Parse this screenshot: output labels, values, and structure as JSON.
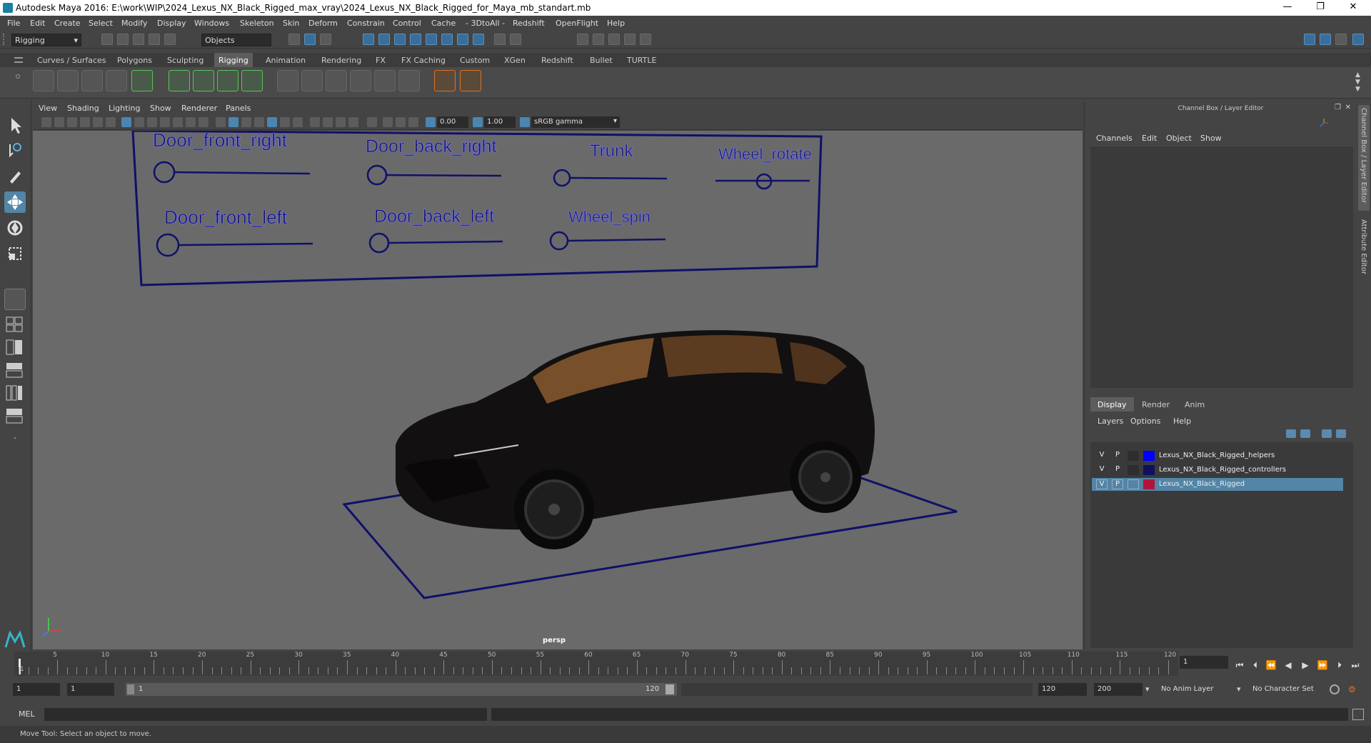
{
  "window": {
    "title": "Autodesk Maya 2016: E:\\work\\WIP\\2024_Lexus_NX_Black_Rigged_max_vray\\2024_Lexus_NX_Black_Rigged_for_Maya_mb_standart.mb",
    "minimize": "—",
    "maximize": "❐",
    "close": "✕"
  },
  "menubar": [
    "File",
    "Edit",
    "Create",
    "Select",
    "Modify",
    "Display",
    "Windows",
    "Skeleton",
    "Skin",
    "Deform",
    "Constrain",
    "Control",
    "Cache",
    "- 3DtoAll -",
    "Redshift",
    "OpenFlight",
    "Help"
  ],
  "statusline": {
    "mode": "Rigging",
    "objects": "Objects"
  },
  "shelf_tabs": [
    "Curves / Surfaces",
    "Polygons",
    "Sculpting",
    "Rigging",
    "Animation",
    "Rendering",
    "FX",
    "FX Caching",
    "Custom",
    "XGen",
    "Redshift",
    "Bullet",
    "TURTLE"
  ],
  "viewport": {
    "menus": [
      "View",
      "Shading",
      "Lighting",
      "Show",
      "Renderer",
      "Panels"
    ],
    "exposure": "0.00",
    "gamma": "1.00",
    "colorspace": "sRGB gamma",
    "camera": "persp"
  },
  "controls": {
    "door_front_right": "Door_front_right",
    "door_back_right": "Door_back_right",
    "trunk": "Trunk",
    "wheel_rotate": "Wheel_rotate",
    "door_front_left": "Door_front_left",
    "door_back_left": "Door_back_left",
    "wheel_spin": "Wheel_spin"
  },
  "channelbox": {
    "title": "Channel Box / Layer Editor",
    "menus": [
      "Channels",
      "Edit",
      "Object",
      "Show"
    ]
  },
  "layer_editor": {
    "tabs": [
      "Display",
      "Render",
      "Anim"
    ],
    "menus": [
      "Layers",
      "Options",
      "Help"
    ],
    "layers": [
      {
        "v": "V",
        "p": "P",
        "color": "#0000ff",
        "name": "Lexus_NX_Black_Rigged_helpers"
      },
      {
        "v": "V",
        "p": "P",
        "color": "#101060",
        "name": "Lexus_NX_Black_Rigged_controllers"
      },
      {
        "v": "V",
        "p": "P",
        "color": "#b0143c",
        "name": "Lexus_NX_Black_Rigged"
      }
    ]
  },
  "side_tabs": [
    "Channel Box / Layer Editor",
    "Attribute Editor"
  ],
  "timeline": {
    "ticks": [
      "1",
      "5",
      "10",
      "15",
      "20",
      "25",
      "30",
      "35",
      "40",
      "45",
      "50",
      "55",
      "60",
      "65",
      "70",
      "75",
      "80",
      "85",
      "90",
      "95",
      "100",
      "105",
      "110",
      "115",
      "120"
    ],
    "current_frame": "1"
  },
  "range": {
    "start": "1",
    "playback_start": "1",
    "slider_start": "1",
    "slider_end": "120",
    "playback_end": "120",
    "end": "200",
    "anim_layer": "No Anim Layer",
    "character_set": "No Character Set"
  },
  "cmdline": {
    "label": "MEL"
  },
  "helpline": {
    "text": "Move Tool: Select an object to move."
  }
}
